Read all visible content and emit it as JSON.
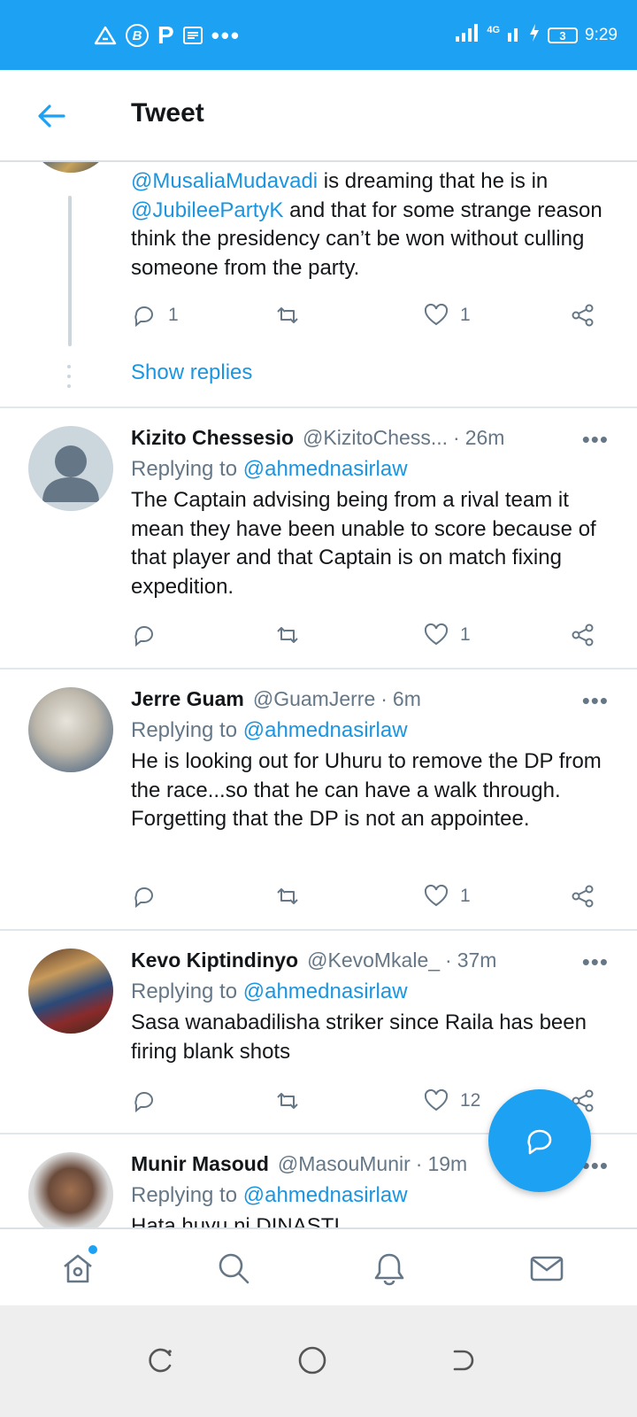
{
  "status_bar": {
    "network": "4G",
    "battery": "3",
    "time": "9:29"
  },
  "header": {
    "title": "Tweet"
  },
  "thread_tweet": {
    "body_mentions": [
      "@MusaliaMudavadi",
      "@JubileePartyK"
    ],
    "body_text_1": " is dreaming that he is in ",
    "body_text_2": " and that for some strange reason think the presidency can’t be won without culling someone from the party.",
    "reply_count": "1",
    "like_count": "1",
    "show_replies": "Show replies"
  },
  "replies": [
    {
      "name": "Kizito Chessesio",
      "handle": "@KizitoChess...",
      "time": "26m",
      "replying_prefix": "Replying to ",
      "replying_to": "@ahmednasirlaw",
      "body": "The Captain advising being from a rival team it mean they have been unable to score because of that player and that Captain is on match fixing expedition.",
      "reply_count": "",
      "retweet_count": "",
      "like_count": "1"
    },
    {
      "name": "Jerre Guam",
      "handle": "@GuamJerre",
      "time": "6m",
      "replying_prefix": "Replying to ",
      "replying_to": "@ahmednasirlaw",
      "body": "He is looking out for Uhuru to remove the DP from the race...so that he can have a walk through. Forgetting that the DP is not an appointee.",
      "reply_count": "",
      "retweet_count": "",
      "like_count": "1"
    },
    {
      "name": "Kevo Kiptindinyo",
      "handle": "@KevoMkale_",
      "time": "37m",
      "replying_prefix": "Replying to ",
      "replying_to": "@ahmednasirlaw",
      "body": "Sasa wanabadilisha striker since Raila has been firing blank shots",
      "reply_count": "",
      "retweet_count": "",
      "like_count": "12"
    },
    {
      "name": "Munir Masoud",
      "handle": "@MasouMunir",
      "time": "19m",
      "replying_prefix": "Replying to ",
      "replying_to": "@ahmednasirlaw",
      "body": "Hata huyu ni DINASTI"
    }
  ],
  "colors": {
    "brand": "#1da1f2",
    "link": "#1b95e0",
    "muted": "#657786"
  },
  "icons": {
    "home": "home-icon",
    "search": "search-icon",
    "notifications": "bell-icon",
    "messages": "mail-icon",
    "compose": "compose-reply-icon"
  }
}
